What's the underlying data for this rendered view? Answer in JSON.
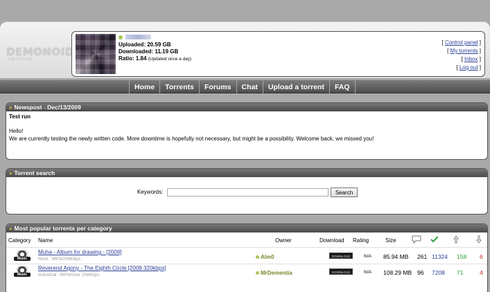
{
  "header": {
    "logo": {
      "text": "DEMONOID",
      "tagline": "THE FUTURE"
    },
    "user": {
      "uploaded": "Uploaded: 20.59 GB",
      "downloaded": "Downloaded: 11.19 GB",
      "ratio_label": "Ratio: 1.84",
      "ratio_note": "(Updated once a day)"
    },
    "links": {
      "control_panel": "Control panel",
      "my_torrents": "My torrents",
      "inbox": "Inbox",
      "log_out": "Log out"
    }
  },
  "nav": [
    "Home",
    "Torrents",
    "Forums",
    "Chat",
    "Upload a torrent",
    "FAQ"
  ],
  "newspost": {
    "title": "Newspost - Dec/13/2009",
    "heading": "Test run",
    "line1": "Hello!",
    "line2": "We are currently testing the newly written code. More downtime is hopefully not necessary, but might be a possibility. Welcome back, we missed you!"
  },
  "search": {
    "title": "Torrent search",
    "keywords_label": "Keywords:",
    "button": "Search"
  },
  "popular": {
    "title": "Most popular torrents per category",
    "columns": [
      "Category",
      "Name",
      "Owner",
      "Download",
      "Rating",
      "Size"
    ],
    "rows": [
      {
        "category": "Music",
        "name": "Muha - Album for drawing - [2009]",
        "genre": "Rock",
        "format": "MP3/256Kbps",
        "owner": "Alm0",
        "download": "DOWNLOAD",
        "rating": "N/A",
        "size": "85.94 MB",
        "comments": "261",
        "completed": "11324",
        "seeders": "158",
        "leechers": "6"
      },
      {
        "category": "Music",
        "name": "Reverend Agony - The Eighth Circle [2008 320kbps]",
        "genre": "Industrial",
        "format": "MP3/Over 256Kbps",
        "owner": "MrDementia",
        "download": "DOWNLOAD",
        "rating": "N/A",
        "size": "108.29 MB",
        "comments": "96",
        "completed": "7208",
        "seeders": "71",
        "leechers": "4"
      }
    ]
  }
}
